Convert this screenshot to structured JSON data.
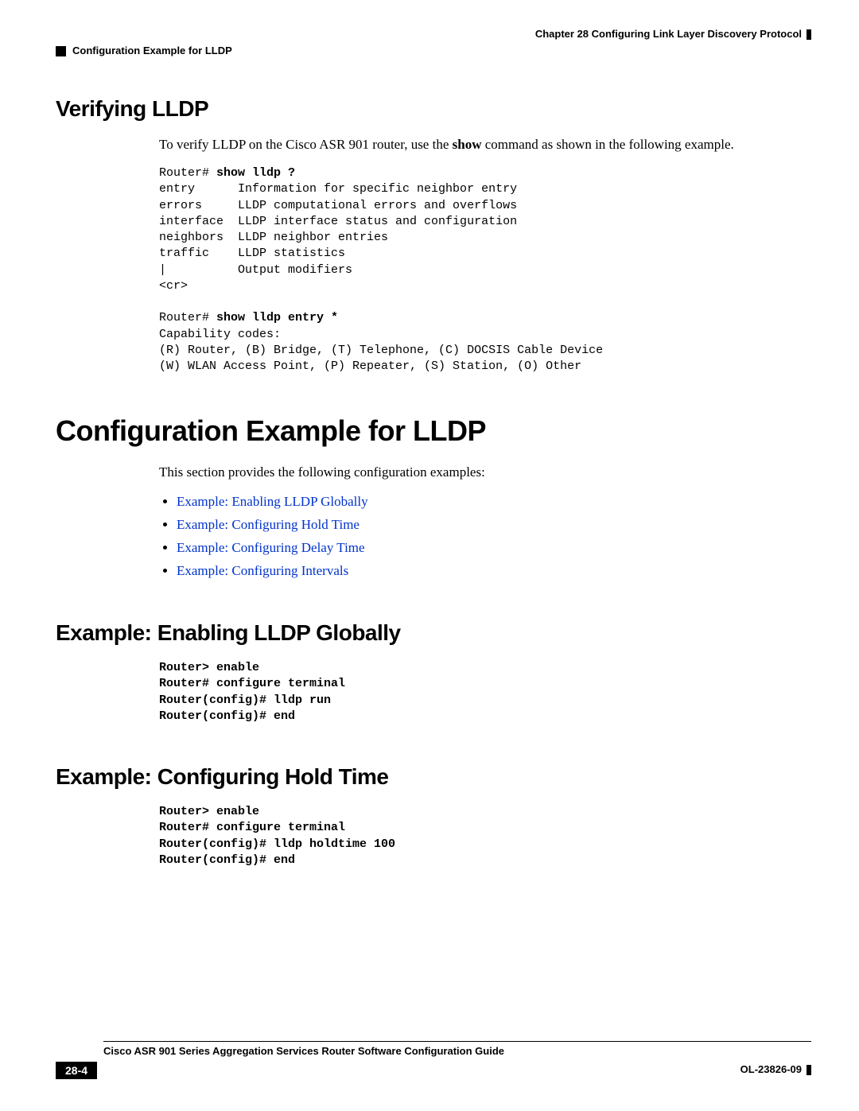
{
  "header": {
    "chapter": "Chapter 28      Configuring Link Layer Discovery Protocol",
    "section": "Configuration Example for LLDP"
  },
  "s1": {
    "title": "Verifying LLDP",
    "intro_a": "To verify LLDP on the Cisco ASR 901 router, use the ",
    "intro_b": "show",
    "intro_c": " command as shown in the following example.",
    "code": {
      "l01a": "Router# ",
      "l01b": "show lldp ?",
      "l02": "entry      Information for specific neighbor entry",
      "l03": "errors     LLDP computational errors and overflows",
      "l04": "interface  LLDP interface status and configuration",
      "l05": "neighbors  LLDP neighbor entries",
      "l06": "traffic    LLDP statistics",
      "l07": "|          Output modifiers",
      "l08": "<cr>",
      "l09": "",
      "l10a": "Router# ",
      "l10b": "show lldp entry *",
      "l11": "Capability codes:",
      "l12": "(R) Router, (B) Bridge, (T) Telephone, (C) DOCSIS Cable Device",
      "l13": "(W) WLAN Access Point, (P) Repeater, (S) Station, (O) Other"
    }
  },
  "s2": {
    "title": "Configuration Example for LLDP",
    "intro": "This section provides the following configuration examples:",
    "links": {
      "a": "Example: Enabling LLDP Globally",
      "b": "Example: Configuring Hold Time",
      "c": "Example: Configuring Delay Time",
      "d": "Example: Configuring Intervals"
    }
  },
  "s3": {
    "title": "Example: Enabling LLDP Globally",
    "code": {
      "l1": "Router> enable",
      "l2": "Router# configure terminal",
      "l3": "Router(config)# lldp run",
      "l4": "Router(config)# end"
    }
  },
  "s4": {
    "title": "Example: Configuring Hold Time",
    "code": {
      "l1": "Router> enable",
      "l2": "Router# configure terminal",
      "l3": "Router(config)# lldp holdtime 100",
      "l4": "Router(config)# end"
    }
  },
  "footer": {
    "guide": "Cisco ASR 901 Series Aggregation Services Router Software Configuration Guide",
    "page": "28-4",
    "docid": "OL-23826-09"
  }
}
